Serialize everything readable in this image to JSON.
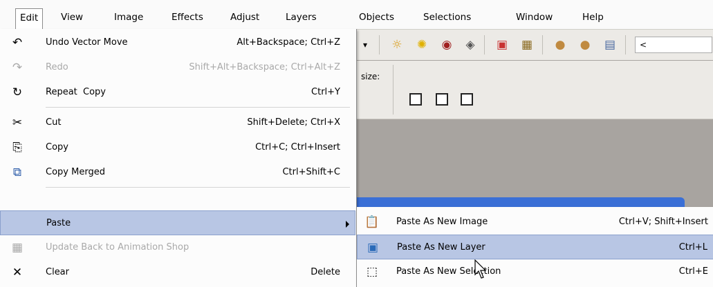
{
  "menubar": {
    "items": [
      "Edit",
      "View",
      "Image",
      "Effects",
      "Adjust",
      "Layers",
      "Objects",
      "Selections",
      "Window",
      "Help"
    ]
  },
  "toolbar": {
    "size_label": "size:",
    "dropdown_glyph": "▾",
    "overflow_glyph": "<"
  },
  "edit_menu": {
    "items": [
      {
        "label": "Undo Vector Move",
        "shortcut": "Alt+Backspace; Ctrl+Z",
        "icon": "undo-icon"
      },
      {
        "label": "Redo",
        "shortcut": "Shift+Alt+Backspace; Ctrl+Alt+Z",
        "icon": "redo-icon",
        "disabled": true
      },
      {
        "label": "Repeat  Copy",
        "shortcut": "Ctrl+Y",
        "icon": "repeat-icon"
      },
      {
        "label": "Cut",
        "shortcut": "Shift+Delete; Ctrl+X",
        "icon": "scissors-icon"
      },
      {
        "label": "Copy",
        "shortcut": "Ctrl+C; Ctrl+Insert",
        "icon": "copy-icon"
      },
      {
        "label": "Copy Merged",
        "shortcut": "Ctrl+Shift+C",
        "icon": "copy-merged-icon"
      },
      {
        "label": "Paste",
        "shortcut": "",
        "icon": ""
      },
      {
        "label": "Update Back to Animation Shop",
        "shortcut": "",
        "icon": "animation-shop-icon",
        "disabled": true
      },
      {
        "label": "Clear",
        "shortcut": "Delete",
        "icon": "clear-x-icon"
      }
    ]
  },
  "paste_submenu": {
    "items": [
      {
        "label": "Paste As New Image",
        "shortcut": "Ctrl+V; Shift+Insert",
        "icon": "paste-image-icon"
      },
      {
        "label": "Paste As New Layer",
        "shortcut": "Ctrl+L",
        "icon": "paste-layer-icon"
      },
      {
        "label": "Paste As New Selection",
        "shortcut": "Ctrl+E",
        "icon": "paste-selection-icon"
      }
    ]
  },
  "colors": {
    "highlight": "#b8c6e4",
    "highlight_border": "#8aa0cc",
    "disabled_text": "#a9a9a9",
    "workspace": "#a8a4a0"
  }
}
